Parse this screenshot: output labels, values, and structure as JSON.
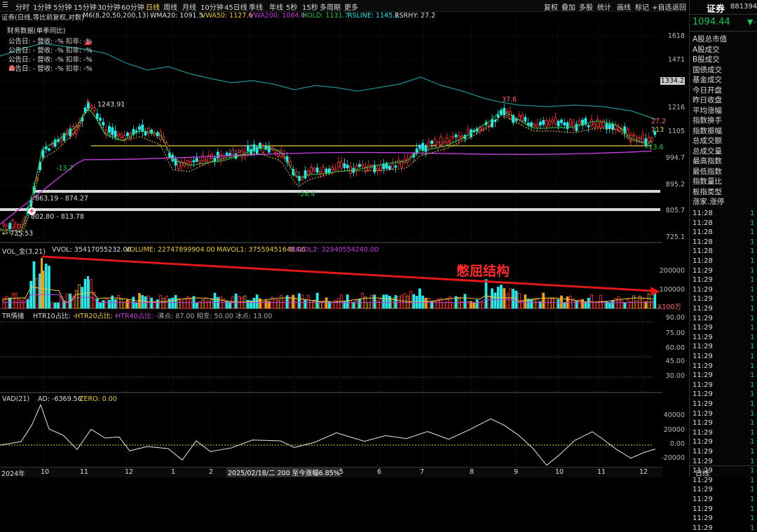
{
  "toolbar": {
    "periods": [
      "分时",
      "1分钟",
      "5分钟",
      "15分钟",
      "30分钟",
      "60分钟",
      "日线",
      "周线",
      "月线",
      "10分钟",
      "45日线",
      "季线",
      "年线",
      "5秒",
      "15秒",
      "多周期",
      "更多"
    ],
    "active_index": 6,
    "right": [
      "复权",
      "叠加",
      "多股",
      "统计",
      "画线",
      "标记",
      "+自选",
      "返回"
    ]
  },
  "header_line": {
    "title": "证券(日线,等比前复权,对数)",
    "m6": "M6(8,20,50,200,13)",
    "wma20": "WMA20: 1091.5",
    "vwa50": "VWA50: 1127.6",
    "vwa200": "VWA200: 1084.0",
    "hold": "HOLD: 1131.7",
    "rsline": "RSLINE: 1145.2",
    "rsrhy": "RSRHY: 27.2"
  },
  "finance": {
    "title": "财务数据(单季同比)",
    "rows": [
      "公告日: -   营收: -%   扣非: -%",
      "公告日: -   营收: -%   扣非: -%",
      "公告日: -   营收: -%   扣非: -%",
      "公告日: -   营收: -%   扣非: -%"
    ]
  },
  "price_axis": [
    "1618",
    "1471",
    "1334.2",
    "1216",
    "1105",
    "994.7",
    "895.2",
    "805.7",
    "725.1"
  ],
  "price_labels": {
    "high": "1243.91",
    "p37": "37.6",
    "m13": "-13.7",
    "m26": "-26.4",
    "r27": "27.2",
    "r113": "113",
    "m136": "-13.6",
    "range1": "863.19 - 874.27",
    "range2": "802.80 - 813.78",
    "low": "735.53"
  },
  "volume": {
    "legend": "VOL_金(3,21)",
    "vvol": "VVOL: 35417055232.00",
    "volume": "VOLUME: 22747899904.00",
    "mavol1": "MAVOL1: 37559451648.00",
    "mavol2": "MAVOL2: 32940554240.00",
    "annotation": "憋屈结构",
    "axis": [
      "200000",
      "100000",
      "X100万"
    ]
  },
  "tr": {
    "legend": "TR情绪",
    "htr10": "HTR10占比: -",
    "htr20": "HTR20占比: -",
    "htr40": "HTR40占比: -",
    "rest": "沸点: 87.00   相变: 50.00   冰点: 13.00",
    "axis": [
      "90.00",
      "75.00",
      "60.00",
      "45.00",
      "30.00"
    ]
  },
  "vad": {
    "legend": "VAD(21)",
    "ad": "AD: -6369.56",
    "zero": "ZERO: 0.00",
    "axis": [
      "40000",
      "20000",
      "0.00",
      "-20000"
    ]
  },
  "date_axis": [
    "2024年",
    "10",
    "11",
    "12",
    "1",
    "2",
    "2025/02/18/二 200 至今涨幅6.85%",
    "5",
    "6",
    "7",
    "8",
    "9",
    "10",
    "11",
    "12"
  ],
  "right_panel": {
    "name": "证券",
    "code": "881394",
    "price": "1094.44",
    "change": "▼-",
    "items": [
      "A股总市值",
      "A股成交",
      "B股成交",
      "国债成交",
      "基金成交",
      "今日开盘",
      "昨日收盘",
      "平均涨幅",
      "指数换手",
      "指数振幅",
      "总成交额",
      "总成交量",
      "最高指数",
      "最低指数",
      "指数量比",
      "板指类型",
      "涨家.涨停"
    ],
    "times": [
      "11:28",
      "11:28",
      "11:28",
      "11:28",
      "11:28",
      "11:28",
      "11:29",
      "11:29",
      "11:29",
      "11:29",
      "11:29",
      "11:29",
      "11:29",
      "11:29",
      "11:29",
      "11:29",
      "11:29",
      "11:29",
      "11:29",
      "11:29",
      "11:29",
      "11:29",
      "11:29",
      "11:29",
      "11:29",
      "11:29",
      "11:29",
      "11:29",
      "11:29",
      "11:29",
      "11:29",
      "11:29",
      "11:29",
      "11:29"
    ],
    "bottom_tab": "日线"
  },
  "colors": {
    "up": "#ff3b3b",
    "down": "#2ee6e6",
    "yellow": "#e8c84a",
    "magenta": "#c03fd8",
    "green": "#2ec94a",
    "teal": "#1f8f8f",
    "arrow": "#e01818"
  }
}
